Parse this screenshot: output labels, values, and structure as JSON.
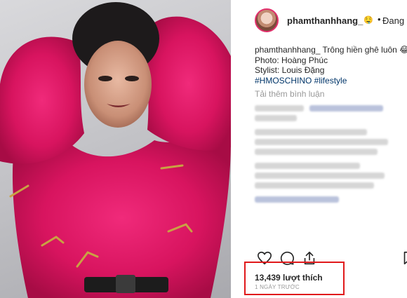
{
  "post": {
    "username": "phamthanhhang_",
    "emoji": "🤤",
    "dot": "•",
    "follow_status": "Đang theo dõi"
  },
  "caption": {
    "username": "phamthanhhang_",
    "text": "Trông hiền ghê luôn",
    "trailing": "😂",
    "photo_credit": "Photo: Hoàng Phúc",
    "stylist_credit": "Stylist: Louis Đặng",
    "hashtags": "#HMOSCHINO #lifestyle"
  },
  "comments": {
    "load_more": "Tải thêm bình luận"
  },
  "actions": {
    "like_icon": "heart-icon",
    "comment_icon": "comment-icon",
    "share_icon": "share-icon",
    "save_icon": "bookmark-icon"
  },
  "stats": {
    "likes": "13,439 lượt thích",
    "date": "1 NGÀY TRƯỚC"
  },
  "colors": {
    "highlight_border": "#e0191b",
    "coat": "#e0196a",
    "hashtag": "#003569"
  }
}
